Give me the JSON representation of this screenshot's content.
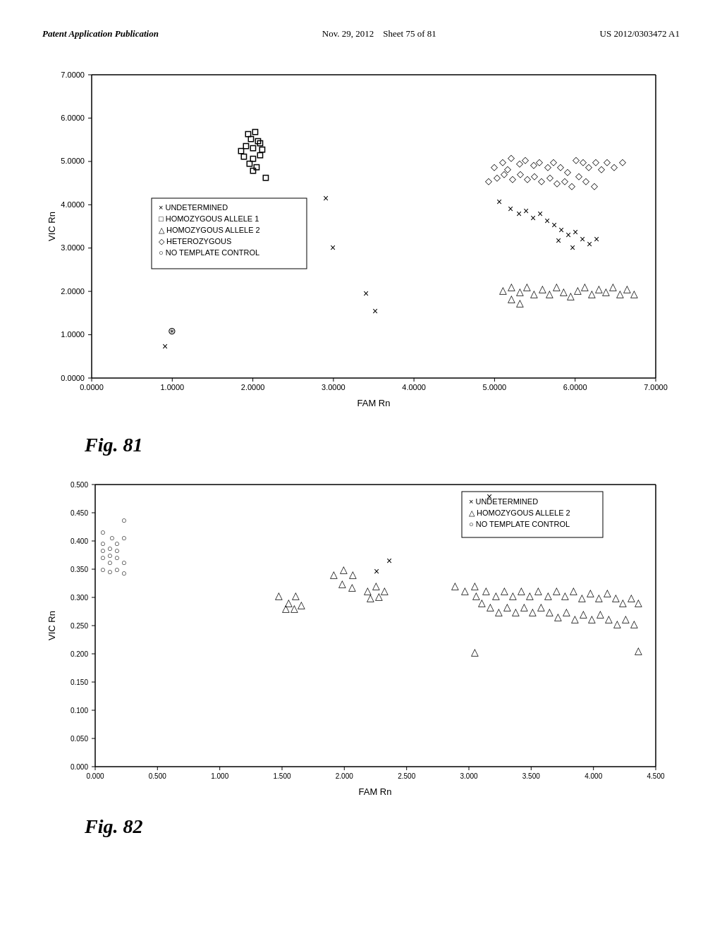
{
  "header": {
    "left": "Patent Application Publication",
    "center": "Nov. 29, 2012",
    "sheet": "Sheet 75 of 81",
    "right": "US 2012/0303472 A1"
  },
  "fig81": {
    "label": "Fig. 81",
    "xaxis": "FAM Rn",
    "yaxis": "VIC Rn",
    "legend": [
      "× UNDETERMINED",
      "□ HOMOZYGOUS ALLELE 1",
      "△ HOMOZYGOUS ALLELE 2",
      "◇ HETEROZYGOUS",
      "○ NO TEMPLATE CONTROL"
    ],
    "xmin": 0,
    "xmax": 7,
    "ymin": 0,
    "ymax": 7
  },
  "fig82": {
    "label": "Fig. 82",
    "xaxis": "FAM Rn",
    "yaxis": "VIC Rn",
    "legend": [
      "× UNDETERMINED",
      "△ HOMOZYGOUS ALLELE 2",
      "○ NO TEMPLATE CONTROL"
    ],
    "xmin": 0,
    "xmax": 4.5,
    "ymin": 0,
    "ymax": 0.5
  }
}
